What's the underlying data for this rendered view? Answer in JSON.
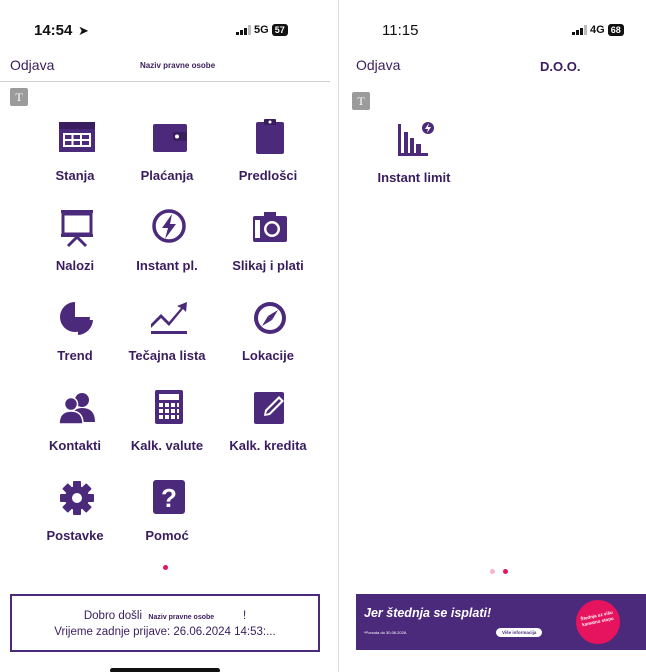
{
  "left": {
    "status": {
      "time": "14:54",
      "network": "5G",
      "battery": "57"
    },
    "topbar": {
      "logout": "Odjava",
      "entity": "Naziv pravne osobe"
    },
    "badge": "T",
    "tiles": [
      {
        "label": "Stanja",
        "icon": "calendar-icon"
      },
      {
        "label": "Plaćanja",
        "icon": "wallet-icon"
      },
      {
        "label": "Predlošci",
        "icon": "clipboard-icon"
      },
      {
        "label": "Nalozi",
        "icon": "presentation-icon"
      },
      {
        "label": "Instant pl.",
        "icon": "lightning-icon"
      },
      {
        "label": "Slikaj i plati",
        "icon": "camera-icon"
      },
      {
        "label": "Trend",
        "icon": "pie-chart-icon"
      },
      {
        "label": "Tečajna lista",
        "icon": "trend-chart-icon"
      },
      {
        "label": "Lokacije",
        "icon": "compass-icon"
      },
      {
        "label": "Kontakti",
        "icon": "contacts-icon"
      },
      {
        "label": "Kalk. valute",
        "icon": "calculator-icon"
      },
      {
        "label": "Kalk. kredita",
        "icon": "edit-icon"
      },
      {
        "label": "Postavke",
        "icon": "gear-icon"
      },
      {
        "label": "Pomoć",
        "icon": "help-icon"
      }
    ],
    "welcome": {
      "greeting": "Dobro došli",
      "entity": "Naziv pravne osobe",
      "exclaim": "!",
      "last_login": "Vrijeme zadnje prijave: 26.06.2024 14:53:..."
    }
  },
  "right": {
    "status": {
      "time": "11:15",
      "network": "4G",
      "battery": "68"
    },
    "topbar": {
      "logout": "Odjava",
      "entity": "D.O.O."
    },
    "badge": "T",
    "tiles": [
      {
        "label": "Instant limit",
        "icon": "bar-chart-lightning-icon"
      }
    ],
    "banner": {
      "headline": "Jer štednja se isplati!",
      "fineprint": "*Ponuda do 30.06.2026.",
      "button": "Više informacija",
      "circle": "Štednja uz višu kamatnu stopu"
    }
  },
  "colors": {
    "brand": "#4b2a7b",
    "accent": "#e6135e",
    "dot_inactive": "#f4b6c8"
  }
}
